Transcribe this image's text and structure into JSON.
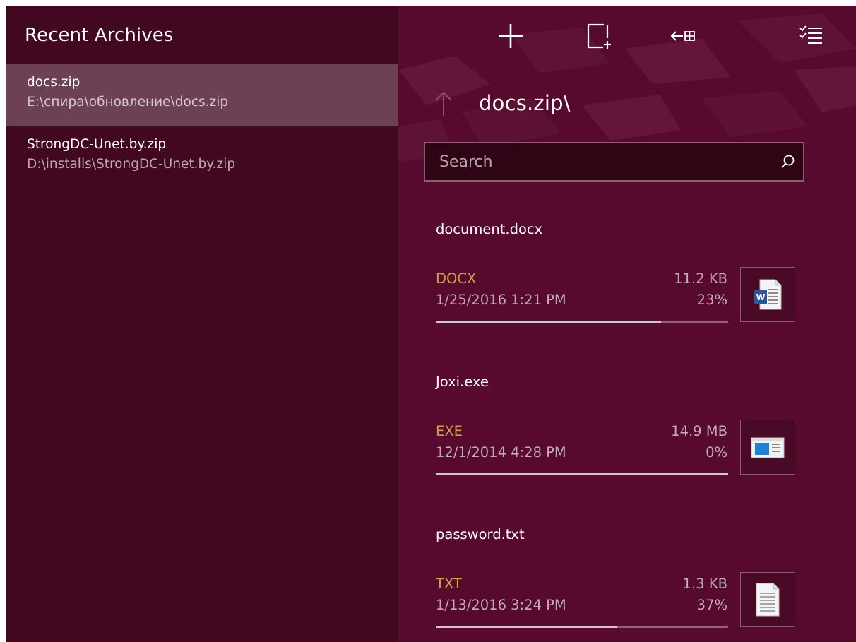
{
  "sidebar": {
    "title": "Recent Archives",
    "archives": [
      {
        "name": "docs.zip",
        "path": "E:\\спира\\обновление\\docs.zip",
        "selected": true
      },
      {
        "name": "StrongDC-Unet.by.zip",
        "path": "D:\\installs\\StrongDC-Unet.by.zip",
        "selected": false
      }
    ]
  },
  "toolbar": {
    "buttons": [
      {
        "icon": "plus-icon"
      },
      {
        "icon": "new-file-icon"
      },
      {
        "icon": "extract-icon"
      },
      {
        "icon": "select-list-icon"
      }
    ]
  },
  "navigation": {
    "current_path": "docs.zip\\",
    "up_icon": "arrow-up-icon"
  },
  "search": {
    "placeholder": "Search",
    "value": "",
    "icon": "search-icon"
  },
  "files": [
    {
      "name": "document.docx",
      "type": "DOCX",
      "date": "1/25/2016 1:21 PM",
      "size": "11.2 KB",
      "ratio_label": "23%",
      "ratio_percent": 77,
      "icon": "word-document-icon"
    },
    {
      "name": "Joxi.exe",
      "type": "EXE",
      "date": "12/1/2014 4:28 PM",
      "size": "14.9 MB",
      "ratio_label": "0%",
      "ratio_percent": 100,
      "icon": "application-icon"
    },
    {
      "name": "password.txt",
      "type": "TXT",
      "date": "1/13/2016 3:24 PM",
      "size": "1.3 KB",
      "ratio_label": "37%",
      "ratio_percent": 62,
      "icon": "text-file-icon"
    }
  ],
  "colors": {
    "sidebar_bg": "#430821",
    "main_bg": "#570a2d",
    "selected_bg": "#6c4156",
    "type_accent": "#c7a24a"
  }
}
